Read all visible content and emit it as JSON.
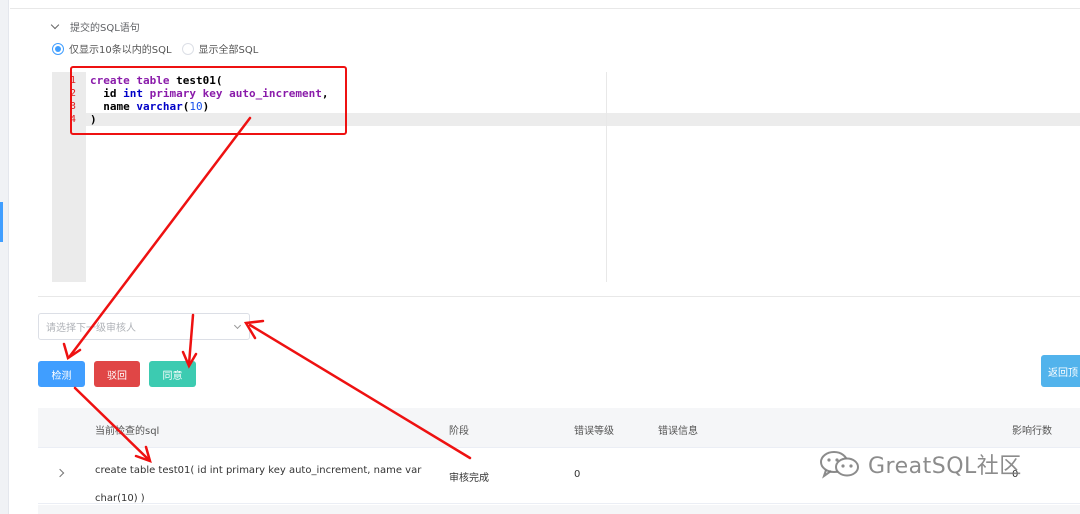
{
  "section": {
    "title": "提交的SQL语句"
  },
  "display_options": [
    {
      "label": "仅显示10条以内的SQL",
      "selected": true
    },
    {
      "label": "显示全部SQL",
      "selected": false
    }
  ],
  "editor": {
    "line_numbers": [
      "1",
      "2",
      "3",
      "4"
    ],
    "lines": [
      {
        "tokens": [
          {
            "t": "create",
            "c": "kw"
          },
          {
            "t": " ",
            "c": ""
          },
          {
            "t": "table",
            "c": "kw"
          },
          {
            "t": " test01(",
            "c": "nm-b"
          }
        ]
      },
      {
        "tokens": [
          {
            "t": "  id ",
            "c": "nm-b"
          },
          {
            "t": "int",
            "c": "ty"
          },
          {
            "t": " ",
            "c": ""
          },
          {
            "t": "primary",
            "c": "kw"
          },
          {
            "t": " ",
            "c": ""
          },
          {
            "t": "key",
            "c": "kw"
          },
          {
            "t": " ",
            "c": ""
          },
          {
            "t": "auto_increment",
            "c": "kw"
          },
          {
            "t": ",",
            "c": "nm-b"
          }
        ]
      },
      {
        "tokens": [
          {
            "t": "  name ",
            "c": "nm-b"
          },
          {
            "t": "varchar",
            "c": "ty"
          },
          {
            "t": "(",
            "c": "nm-b"
          },
          {
            "t": "10",
            "c": "nm"
          },
          {
            "t": ")",
            "c": "nm-b"
          }
        ]
      },
      {
        "tokens": [
          {
            "t": ")",
            "c": "nm-b"
          }
        ]
      }
    ]
  },
  "reviewer_select": {
    "placeholder": "请选择下一级审核人"
  },
  "buttons": {
    "check": "检测",
    "reject": "驳回",
    "agree": "同意",
    "back_top": "返回顶"
  },
  "table": {
    "headers": {
      "sql": "当前检查的sql",
      "stage": "阶段",
      "error_level": "错误等级",
      "error_info": "错误信息",
      "affected_rows": "影响行数"
    },
    "rows": [
      {
        "sql": "create table test01( id int primary key auto_increment, name varchar(10) )",
        "stage": "审核完成",
        "error_level": "0",
        "error_info": "",
        "affected_rows": "0"
      }
    ]
  },
  "watermark": {
    "text": "GreatSQL社区",
    "icon": "wechat-icon"
  },
  "colors": {
    "primary": "#409eff",
    "danger": "#e04646",
    "success": "#3ccbb1",
    "annotation": "#ee1111"
  }
}
